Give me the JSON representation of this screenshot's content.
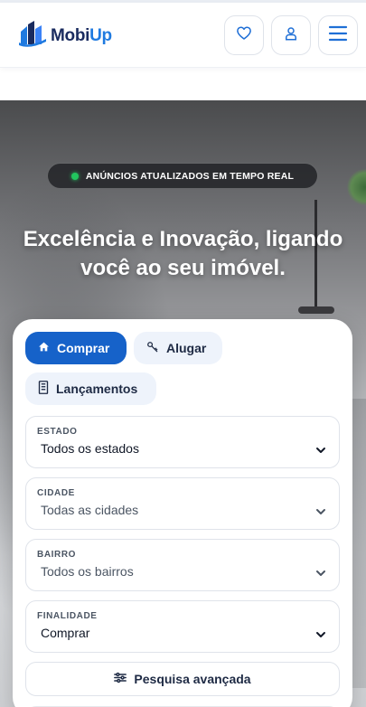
{
  "header": {
    "brand_prefix": "Mobi",
    "brand_suffix": "Up",
    "brand_color": "#1a2b5f",
    "accent_color": "#1f7ae0",
    "icons": [
      "logo-icon",
      "heart-icon",
      "user-icon",
      "menu-icon"
    ]
  },
  "hero": {
    "badge": "ANÚNCIOS ATUALIZADOS EM TEMPO REAL",
    "badge_dot_color": "#22c55e",
    "headline": "Excelência e Inovação, ligando você ao seu imóvel."
  },
  "search": {
    "tabs": [
      {
        "label": "Comprar",
        "icon": "home-icon",
        "active": true
      },
      {
        "label": "Alugar",
        "icon": "key-icon",
        "active": false
      },
      {
        "label": "Lançamentos",
        "icon": "building-icon",
        "active": false
      }
    ],
    "active_color": "#1662c9",
    "fields": [
      {
        "label": "ESTADO",
        "value": "Todos os estados"
      },
      {
        "label": "CIDADE",
        "value": "Todas as cidades"
      },
      {
        "label": "BAIRRO",
        "value": "Todos os bairros"
      },
      {
        "label": "FINALIDADE",
        "value": "Comprar"
      }
    ],
    "advanced_label": "Pesquisa avançada",
    "advanced_icon": "sliders-icon"
  }
}
